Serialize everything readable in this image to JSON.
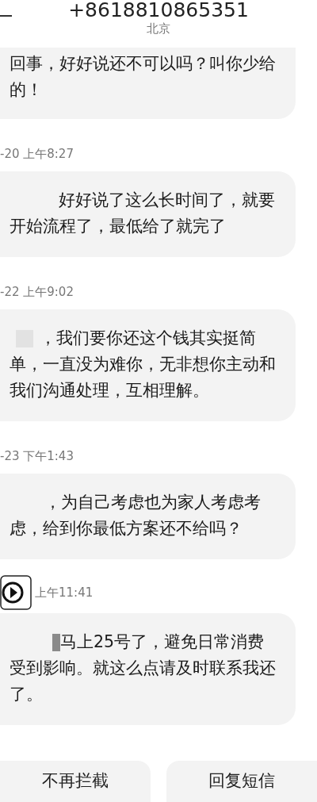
{
  "header": {
    "number": "+8618810865351",
    "location": "北京"
  },
  "messages": [
    {
      "kind": "plain",
      "text": "回事，好好说还不可以吗？叫你少给的！"
    },
    {
      "time": "-20 上午8:27",
      "kind": "blank-indent",
      "text": "好好说了这么长时间了，就要开始流程了，最低给了就完了"
    },
    {
      "time": "-22 上午9:02",
      "kind": "grey-square",
      "text": "，我们要你还这个钱其实挺简单，一直没为难你，无非想你主动和我们沟通处理，互相理解。"
    },
    {
      "time": "-23 下午1:43",
      "kind": "blank-short",
      "text": "，为自己考虑也为家人考虑考虑，给到你最低方案还不给吗？"
    },
    {
      "time": "上午11:41",
      "kind": "bar",
      "play_overlay": true,
      "text": "马上25号了，避免日常消费受到影响。就这么点请及时联系我还了。"
    }
  ],
  "buttons": [
    "不再拦截",
    "回复短信"
  ]
}
